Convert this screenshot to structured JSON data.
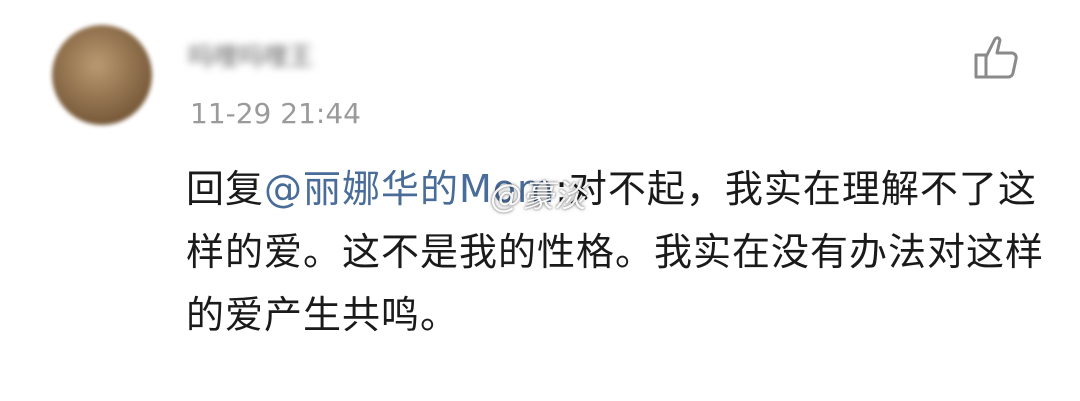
{
  "comment": {
    "username": "吗哩吗哩王",
    "timestamp": "11-29 21:44",
    "reply_prefix": "回复",
    "mention": "@丽娜华的Mom",
    "body": ":对不起，我实在理解不了这样的爱。这不是我的性格。我实在没有办法对这样的爱产生共鸣。",
    "like_icon": "thumbs-up-outline-icon"
  },
  "watermark": "@豪淡",
  "colors": {
    "mention": "#4a6c99",
    "timestamp": "#9a9a9a",
    "text": "#1a1a1a",
    "icon": "#8a8a8a"
  }
}
